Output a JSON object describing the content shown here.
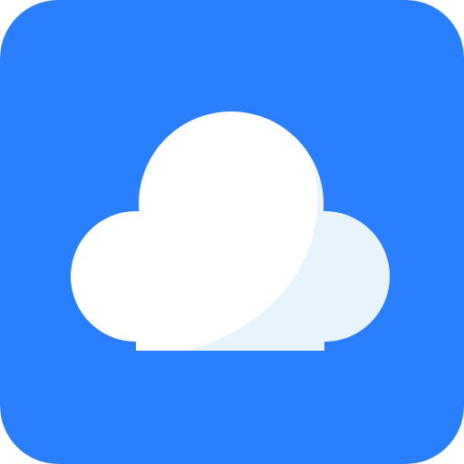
{
  "icon": {
    "name": "cloud-icon",
    "colors": {
      "background": "#2A7FFF",
      "cloud": "#FFFFFF",
      "cloud_shade": "#E8F4FC"
    }
  }
}
